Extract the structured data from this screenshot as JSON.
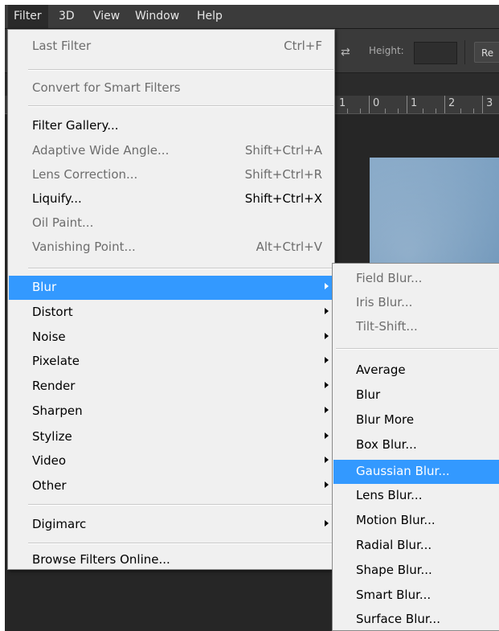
{
  "menubar": {
    "items": [
      {
        "label": "Filter"
      },
      {
        "label": "3D"
      },
      {
        "label": "View"
      },
      {
        "label": "Window"
      },
      {
        "label": "Help"
      }
    ]
  },
  "options_bar": {
    "height_label": "Height:",
    "refine_label": "Re"
  },
  "ruler": {
    "labels": [
      "1",
      "0",
      "1",
      "2",
      "3"
    ]
  },
  "filter_menu": {
    "last_filter": {
      "label": "Last Filter",
      "shortcut": "Ctrl+F"
    },
    "convert_smart": {
      "label": "Convert for Smart Filters"
    },
    "filter_gallery": {
      "label": "Filter Gallery..."
    },
    "adaptive_wide_angle": {
      "label": "Adaptive Wide Angle...",
      "shortcut": "Shift+Ctrl+A"
    },
    "lens_correction": {
      "label": "Lens Correction...",
      "shortcut": "Shift+Ctrl+R"
    },
    "liquify": {
      "label": "Liquify...",
      "shortcut": "Shift+Ctrl+X"
    },
    "oil_paint": {
      "label": "Oil Paint..."
    },
    "vanishing_point": {
      "label": "Vanishing Point...",
      "shortcut": "Alt+Ctrl+V"
    },
    "categories": [
      {
        "label": "Blur"
      },
      {
        "label": "Distort"
      },
      {
        "label": "Noise"
      },
      {
        "label": "Pixelate"
      },
      {
        "label": "Render"
      },
      {
        "label": "Sharpen"
      },
      {
        "label": "Stylize"
      },
      {
        "label": "Video"
      },
      {
        "label": "Other"
      }
    ],
    "digimarc": {
      "label": "Digimarc"
    },
    "browse_online": {
      "label": "Browse Filters Online..."
    }
  },
  "blur_submenu": {
    "items": [
      {
        "label": "Field Blur..."
      },
      {
        "label": "Iris Blur..."
      },
      {
        "label": "Tilt-Shift..."
      },
      {
        "label": "Average"
      },
      {
        "label": "Blur"
      },
      {
        "label": "Blur More"
      },
      {
        "label": "Box Blur..."
      },
      {
        "label": "Gaussian Blur..."
      },
      {
        "label": "Lens Blur..."
      },
      {
        "label": "Motion Blur..."
      },
      {
        "label": "Radial Blur..."
      },
      {
        "label": "Shape Blur..."
      },
      {
        "label": "Smart Blur..."
      },
      {
        "label": "Surface Blur..."
      }
    ]
  },
  "colors": {
    "highlight": "#3399ff",
    "menu_bg": "#f0f0f0",
    "app_bg": "#262626"
  }
}
